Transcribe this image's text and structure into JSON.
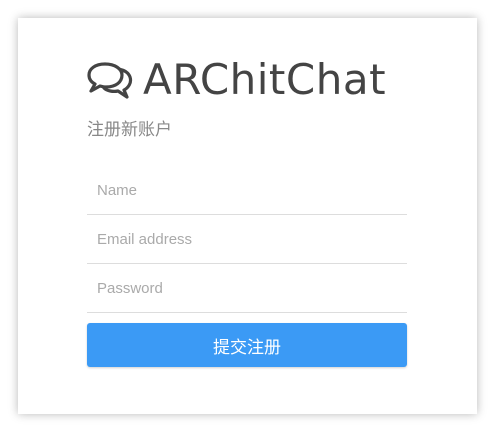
{
  "brand": {
    "title": "ARChitChat",
    "icon": "comments-icon"
  },
  "subtitle": "注册新账户",
  "form": {
    "name_placeholder": "Name",
    "email_placeholder": "Email address",
    "password_placeholder": "Password",
    "submit_label": "提交注册"
  },
  "colors": {
    "accent": "#3b9af5",
    "title": "#444444",
    "subtitle": "#888888",
    "placeholder": "#aaaaaa",
    "divider": "#dddddd"
  }
}
